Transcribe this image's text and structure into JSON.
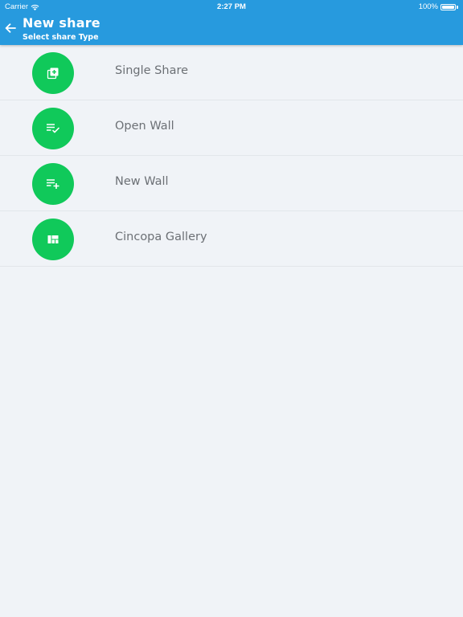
{
  "status_bar": {
    "carrier": "Carrier",
    "time": "2:27 PM",
    "battery": "100%",
    "battery_level": 1.0
  },
  "header": {
    "title": "New share",
    "subtitle": "Select share Type",
    "back_icon": "arrow-left-icon"
  },
  "colors": {
    "header_bg": "#279ade",
    "accent_green": "#10c95a",
    "page_bg": "#f0f3f7",
    "label_text": "#6c7075"
  },
  "share_types": [
    {
      "label": "Single Share",
      "icon": "add-to-library-icon"
    },
    {
      "label": "Open Wall",
      "icon": "playlist-check-icon"
    },
    {
      "label": "New Wall",
      "icon": "playlist-add-icon"
    },
    {
      "label": "Cincopa Gallery",
      "icon": "gallery-grid-icon"
    }
  ]
}
